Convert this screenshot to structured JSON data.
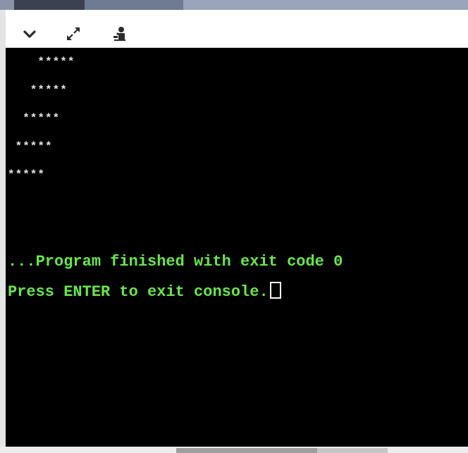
{
  "toolbar": {
    "buttons": [
      {
        "icon": "chevron-down-icon"
      },
      {
        "icon": "expand-icon"
      },
      {
        "icon": "user-settings-icon"
      }
    ]
  },
  "console": {
    "star_lines": [
      "    *****",
      "   *****",
      "  *****",
      " *****",
      "*****"
    ],
    "finished_message": "...Program finished with exit code 0",
    "prompt_message": "Press ENTER to exit console."
  },
  "colors": {
    "console_background": "#000000",
    "output_text": "#e6e6e6",
    "status_text": "#66e84a"
  }
}
